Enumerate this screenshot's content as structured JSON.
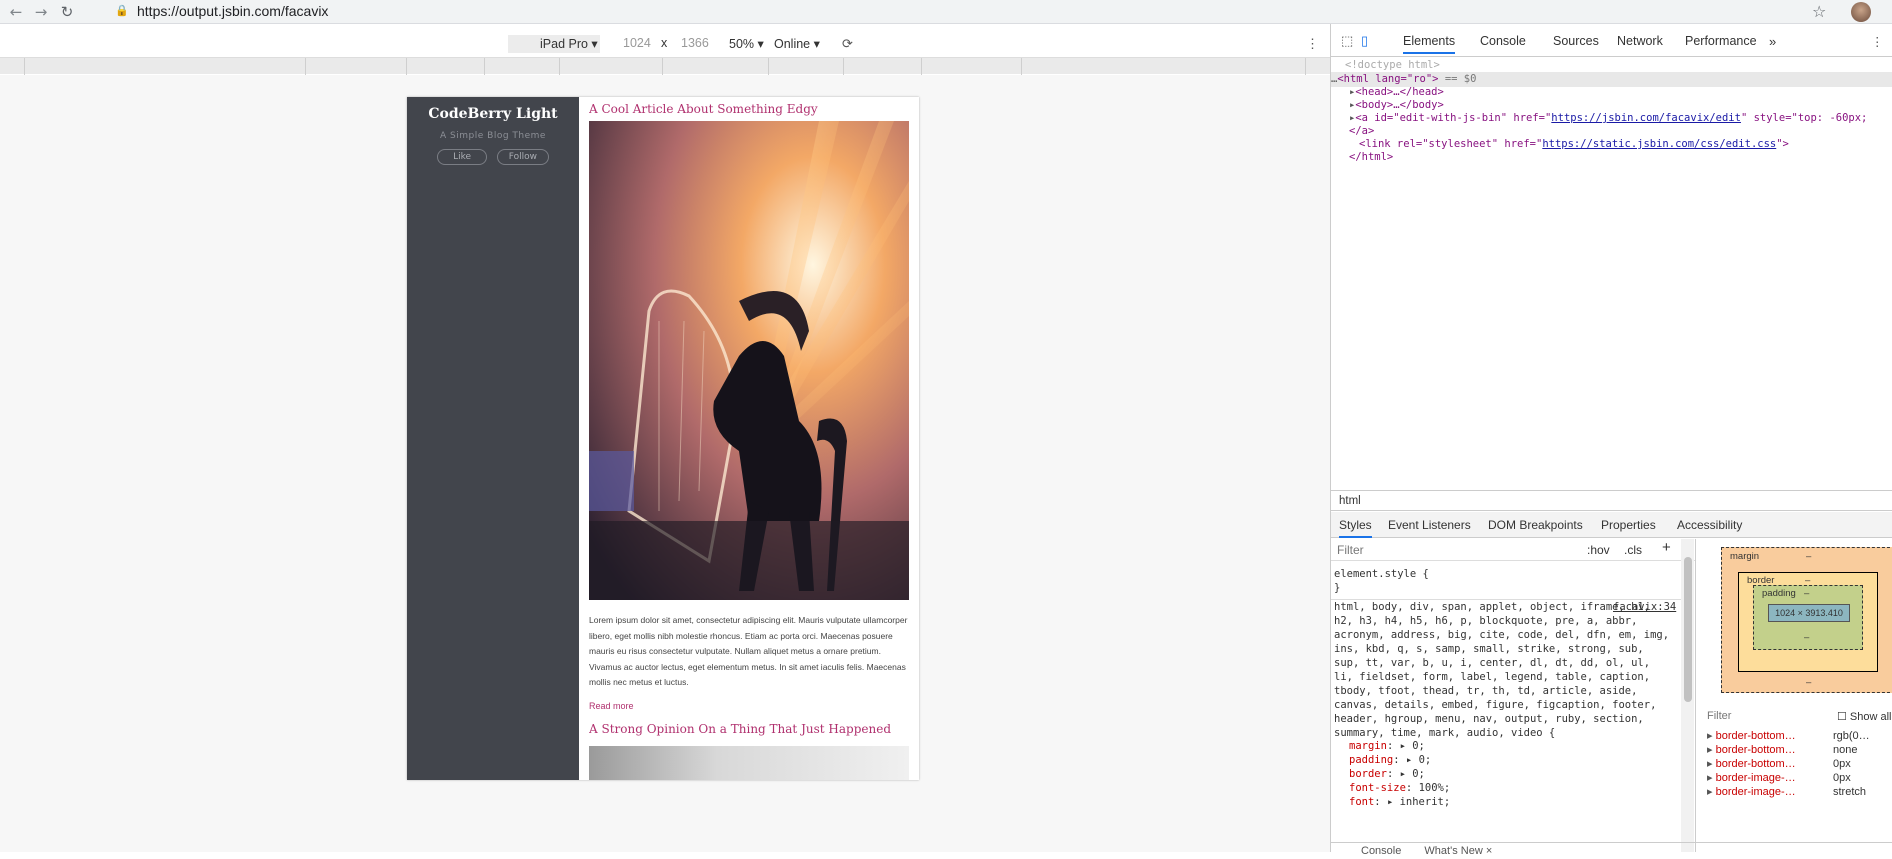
{
  "browser": {
    "url": "https://output.jsbin.com/facavix",
    "icons": [
      "back-icon",
      "forward-icon",
      "reload-icon",
      "lock-icon",
      "star-icon"
    ]
  },
  "device_toolbar": {
    "device": "iPad Pro",
    "width": "1024",
    "times": "x",
    "height": "1366",
    "zoom": "50%",
    "throttle": "Online"
  },
  "blog": {
    "title": "CodeBerry Light",
    "subtitle": "A Simple Blog Theme",
    "like_label": "Like",
    "follow_label": "Follow",
    "article1_title": "A Cool Article About Something Edgy",
    "article1_excerpt": "Lorem ipsum dolor sit amet, consectetur adipiscing elit. Mauris vulputate ullamcorper libero, eget mollis nibh molestie rhoncus. Etiam ac porta orci. Maecenas posuere mauris eu risus consectetur vulputate. Nullam aliquet metus a ornare pretium. Vivamus ac auctor lectus, eget elementum metus. In sit amet iaculis felis. Maecenas mollis nec metus et luctus.",
    "read_more": "Read more",
    "article2_title": "A Strong Opinion On a Thing That Just Happened"
  },
  "devtools": {
    "tabs": [
      "Elements",
      "Console",
      "Sources",
      "Network",
      "Performance"
    ],
    "more": "»",
    "dom": {
      "doctype": "<!doctype html>",
      "html_open": "<html lang=\"ro\">",
      "sel_marker": "== $0",
      "head": "<head>…</head>",
      "body": "<body>…</body>",
      "a_tag": "<a id=\"edit-with-js-bin\" href=\"",
      "a_href": "https://jsbin.com/facavix/edit",
      "a_rest": "\" style=\"top: -60px;",
      "a_close": "</a>",
      "link_tag": "<link rel=\"stylesheet\" href=\"",
      "link_href": "https://static.jsbin.com/css/edit.css",
      "link_close": "\">",
      "html_close": "</html>"
    },
    "crumb": "html",
    "subtabs": [
      "Styles",
      "Event Listeners",
      "DOM Breakpoints",
      "Properties",
      "Accessibility"
    ],
    "filter": "Filter",
    "hov": ":hov",
    "cls": ".cls",
    "element_style_open": "element.style {",
    "element_style_close": "}",
    "source": "facavix:34",
    "selector": "html, body, div, span, applet, object, iframe, h1, h2, h3, h4, h5, h6, p, blockquote, pre, a, abbr, acronym, address, big, cite, code, del, dfn, em, img, ins, kbd, q, s, samp, small, strike, strong, sub, sup, tt, var, b, u, i, center, dl, dt, dd, ol, ul, li, fieldset, form, label, legend, table, caption, tbody, tfoot, thead, tr, th, td, article, aside, canvas, details, embed, figure, figcaption, footer, header, hgroup, menu, nav, output, ruby, section, summary, time, mark, audio, video {",
    "rules": [
      {
        "p": "margin",
        "v": "▸ 0;"
      },
      {
        "p": "padding",
        "v": "▸ 0;"
      },
      {
        "p": "border",
        "v": "▸ 0;"
      },
      {
        "p": "font-size",
        "v": "100%;"
      },
      {
        "p": "font",
        "v": "▸ inherit;"
      }
    ],
    "box_model": {
      "margin": "margin",
      "border": "border",
      "padding": "padding",
      "content": "1024 × 3913.410",
      "dash": "–"
    },
    "computed_filter": "Filter",
    "show_all": "Show all",
    "computed": [
      {
        "p": "border-bottom…",
        "v": "rgb(0…"
      },
      {
        "p": "border-bottom…",
        "v": "none"
      },
      {
        "p": "border-bottom…",
        "v": "0px"
      },
      {
        "p": "border-image-…",
        "v": "0px"
      },
      {
        "p": "border-image-…",
        "v": "stretch"
      }
    ],
    "drawer": [
      "Console",
      "What's New ×"
    ]
  }
}
